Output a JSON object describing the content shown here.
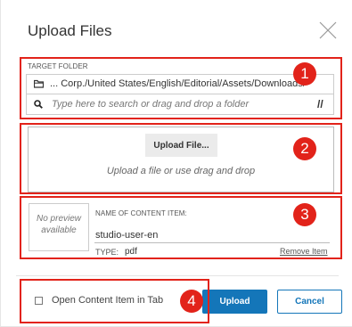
{
  "dialog": {
    "title": "Upload Files",
    "close_icon": "close-icon"
  },
  "target_folder": {
    "label": "TARGET FOLDER",
    "folder_icon": "folder-icon",
    "path": "... Corp./United States/English/Editorial/Assets/Downloads/",
    "search_icon": "search-icon",
    "search_placeholder": "Type here to search or drag and drop a folder",
    "search_value": "",
    "toggle_icon": "double-slash-icon"
  },
  "upload": {
    "button_label": "Upload File...",
    "hint": "Upload a file or use drag and drop"
  },
  "content_item": {
    "preview_line1": "No preview",
    "preview_line2": "available",
    "name_label": "NAME OF CONTENT ITEM:",
    "name_value": "studio-user-en",
    "type_label": "TYPE:",
    "type_value": "pdf",
    "remove_label": "Remove Item"
  },
  "footer": {
    "open_in_tab_label": "Open Content Item in Tab",
    "open_in_tab_checked": false,
    "upload_label": "Upload",
    "cancel_label": "Cancel"
  },
  "callouts": [
    "1",
    "2",
    "3",
    "4"
  ],
  "colors": {
    "callout": "#e2231a",
    "primary": "#1476b9"
  }
}
